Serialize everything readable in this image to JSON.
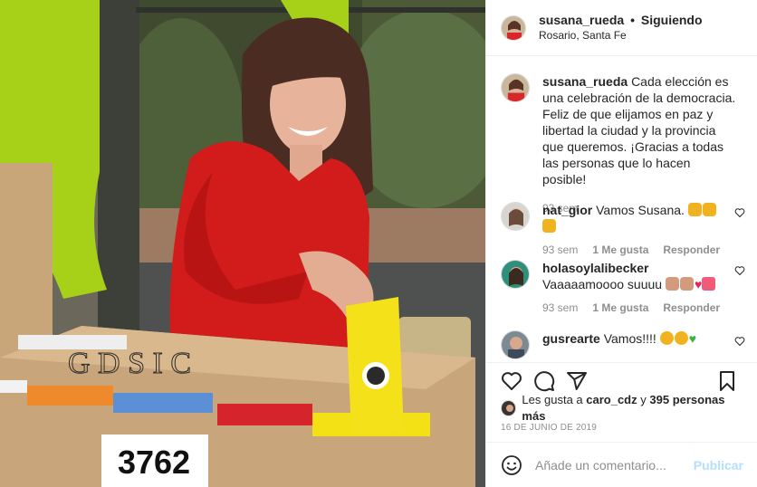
{
  "post": {
    "username": "susana_rueda",
    "follow_status": "Siguiendo",
    "location": "Rosario, Santa Fe",
    "caption": "Cada elección es una celebración de la democracia. Feliz de que elijamos en paz y libertad la ciudad y la provincia que queremos. ¡Gracias a todas las personas que lo hacen posible!",
    "caption_time": "93 sem",
    "photo": {
      "ballot_box_number": "3762",
      "box_letters": "G D S I C"
    }
  },
  "comments": [
    {
      "username": "nat_gior",
      "text": "Vamos Susana.",
      "emojis": [
        "muscle-icon",
        "muscle-icon",
        "muscle-icon"
      ],
      "time": "93 sem",
      "likes": "1 Me gusta",
      "reply": "Responder"
    },
    {
      "username": "holasoylalibecker",
      "text": "Vaaaaamoooo suuuu",
      "emojis": [
        "muscle-icon",
        "muscle-icon",
        "heart-icon",
        "heart-ribbon-icon"
      ],
      "time": "93 sem",
      "likes": "1 Me gusta",
      "reply": "Responder"
    },
    {
      "username": "gusrearte",
      "text": "Vamos!!!!",
      "emojis": [
        "clap-icon",
        "clap-icon",
        "green-heart-icon"
      ]
    }
  ],
  "likes": {
    "prefix": "Les gusta a",
    "user": "caro_cdz",
    "connector": "y",
    "others": "395 personas más"
  },
  "date": "16 DE JUNIO DE 2019",
  "add_comment": {
    "placeholder": "Añade un comentario...",
    "publish": "Publicar"
  },
  "colors": {
    "accent_disabled": "#b2dffc",
    "muted": "#8e8e8e",
    "text": "#262626"
  }
}
